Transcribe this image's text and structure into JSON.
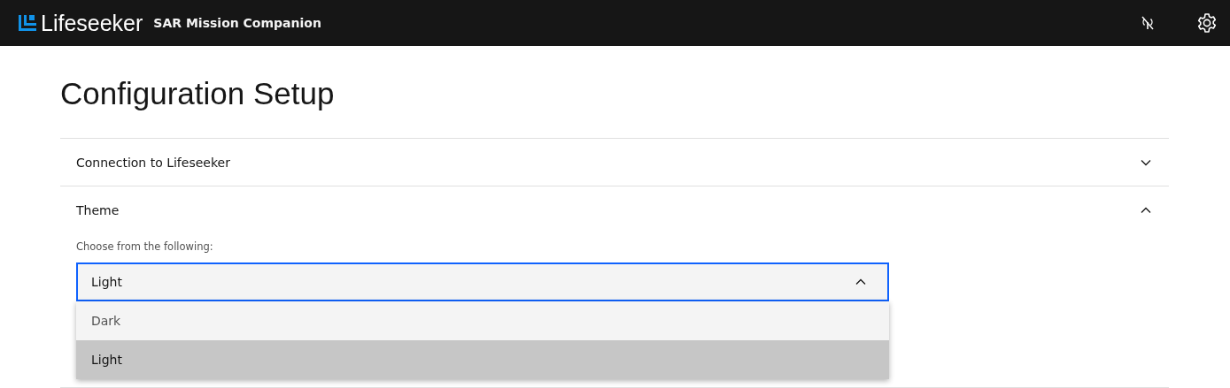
{
  "header": {
    "brand": "Lifeseeker",
    "subtitle": "SAR Mission Companion",
    "connected": false
  },
  "page_title": "Configuration Setup",
  "sections": [
    {
      "title": "Connection to Lifeseeker",
      "expanded": false
    },
    {
      "title": "Theme",
      "expanded": true,
      "label": "Choose from the following:",
      "dropdown": {
        "value": "Light",
        "open": true,
        "options": [
          {
            "label": "Dark",
            "selected": false
          },
          {
            "label": "Light",
            "selected": true
          }
        ]
      }
    }
  ]
}
